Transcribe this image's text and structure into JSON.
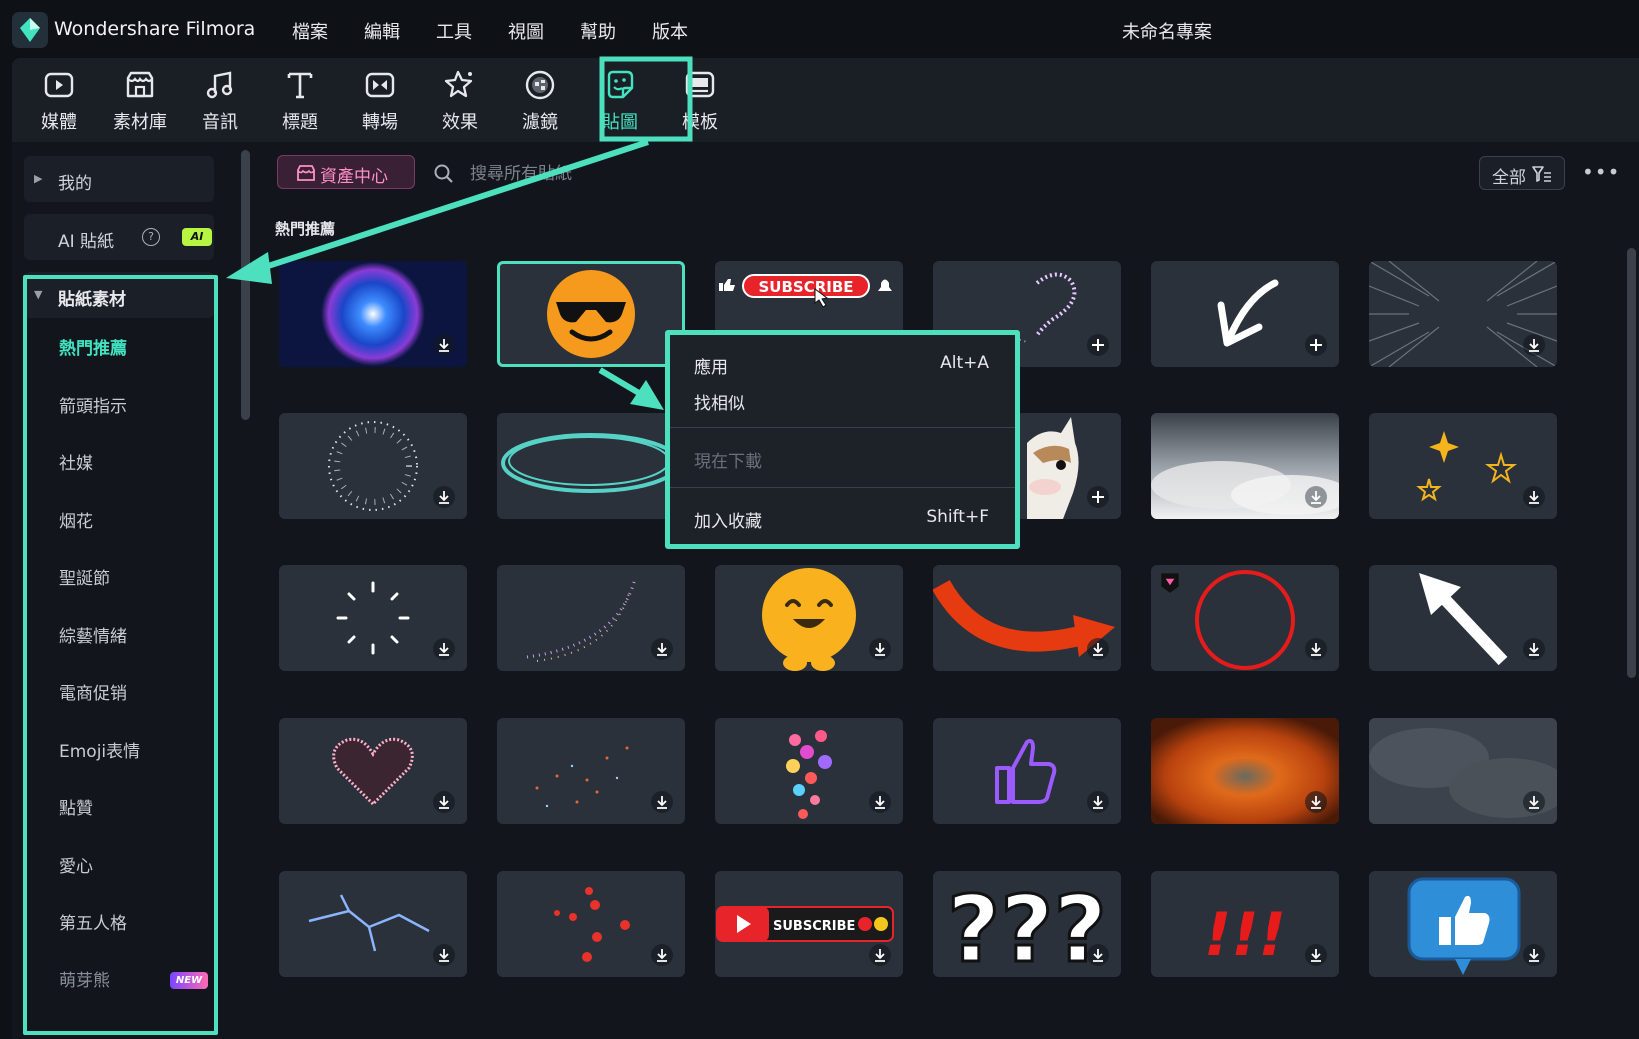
{
  "app": {
    "name": "Wondershare Filmora",
    "project_title": "未命名專案"
  },
  "menu": [
    "檔案",
    "編輯",
    "工具",
    "視圖",
    "幫助",
    "版本"
  ],
  "toolbar": [
    {
      "label": "媒體",
      "icon": "media-icon"
    },
    {
      "label": "素材庫",
      "icon": "stock-library-icon"
    },
    {
      "label": "音訊",
      "icon": "music-note-icon"
    },
    {
      "label": "標題",
      "icon": "title-text-icon"
    },
    {
      "label": "轉場",
      "icon": "transition-icon"
    },
    {
      "label": "效果",
      "icon": "effects-icon"
    },
    {
      "label": "濾鏡",
      "icon": "filter-icon"
    },
    {
      "label": "貼圖",
      "icon": "sticker-icon",
      "active": true
    },
    {
      "label": "模板",
      "icon": "template-icon"
    }
  ],
  "sidebar": {
    "mine": "我的",
    "ai_sticker": "AI 貼紙",
    "ai_badge": "AI",
    "group_title": "貼紙素材",
    "categories": [
      "熱門推薦",
      "箭頭指示",
      "社媒",
      "烟花",
      "聖誕節",
      "綜藝情緒",
      "電商促销",
      "Emoji表情",
      "點贊",
      "愛心",
      "第五人格",
      "萌芽熊"
    ],
    "new_badge": "NEW"
  },
  "main": {
    "asset_center": "資產中心",
    "search_placeholder": "搜尋所有貼紙",
    "filter_label": "全部",
    "section_title": "熱門推薦",
    "subscribe_text": "SUBSCRIBE",
    "question_text": "???",
    "exclaim_text": "!!!"
  },
  "context_menu": {
    "apply": "應用",
    "apply_shortcut": "Alt+A",
    "find_similar": "找相似",
    "download_now": "現在下載",
    "add_favorite": "加入收藏",
    "add_favorite_shortcut": "Shift+F"
  },
  "colors": {
    "accent": "#42e3c1",
    "highlight": "#4de0bf",
    "asset_pink": "#ff8fc8"
  }
}
